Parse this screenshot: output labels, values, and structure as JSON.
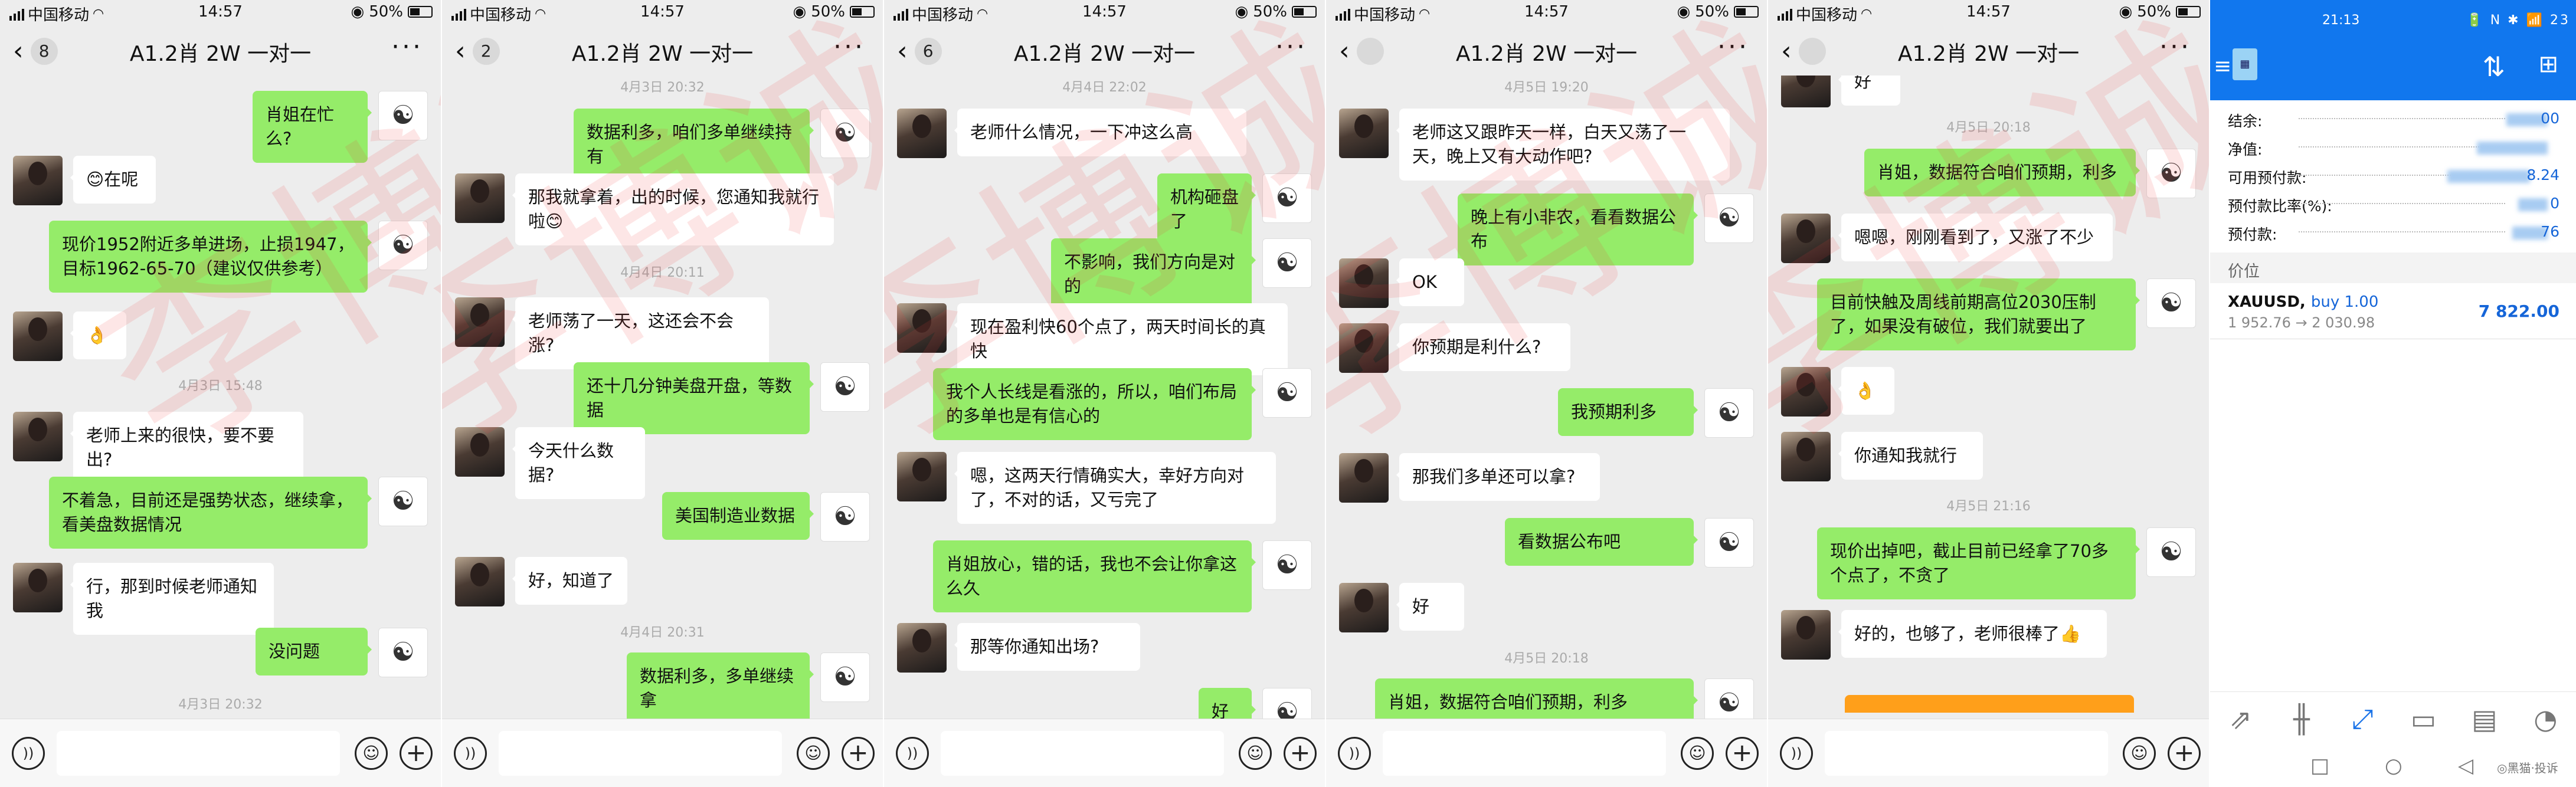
{
  "status": {
    "carrier": "中国移动",
    "time": "14:57",
    "battery": "50%"
  },
  "chat_title": "A1.2肖 2W 一对一",
  "panels": [
    {
      "unread": "8",
      "messages": [
        {
          "type": "out",
          "text": "肖姐在忙么?"
        },
        {
          "type": "in",
          "text": "😊在呢"
        },
        {
          "type": "out",
          "text": "现价1952附近多单进场，止损1947，目标1962-65-70（建议仅供参考）"
        },
        {
          "type": "in",
          "text": "👌"
        },
        {
          "type": "time",
          "text": "4月3日 15:48"
        },
        {
          "type": "in",
          "text": "老师上来的很快，要不要出?"
        },
        {
          "type": "out",
          "text": "不着急，目前还是强势状态，继续拿，看美盘数据情况"
        },
        {
          "type": "in",
          "text": "行，那到时候老师通知我"
        },
        {
          "type": "out",
          "text": "没问题"
        },
        {
          "type": "time",
          "text": "4月3日 20:32"
        }
      ]
    },
    {
      "unread": "2",
      "messages": [
        {
          "type": "time",
          "text": "4月3日 20:32"
        },
        {
          "type": "out",
          "text": "数据利多，咱们多单继续持有"
        },
        {
          "type": "in",
          "text": "那我就拿着，出的时候，您通知我就行啦😊"
        },
        {
          "type": "time",
          "text": "4月4日 20:11"
        },
        {
          "type": "in",
          "text": "老师荡了一天，这还会不会涨?"
        },
        {
          "type": "out",
          "text": "还十几分钟美盘开盘，等数据"
        },
        {
          "type": "in",
          "text": "今天什么数据?"
        },
        {
          "type": "out",
          "text": "美国制造业数据"
        },
        {
          "type": "in",
          "text": "好，知道了"
        },
        {
          "type": "time",
          "text": "4月4日 20:31"
        },
        {
          "type": "out",
          "text": "数据利多，多单继续拿"
        }
      ]
    },
    {
      "unread": "6",
      "messages": [
        {
          "type": "time",
          "text": "4月4日 22:02"
        },
        {
          "type": "in",
          "text": "老师什么情况，一下冲这么高"
        },
        {
          "type": "out",
          "text": "机构砸盘了"
        },
        {
          "type": "out",
          "text": "不影响，我们方向是对的"
        },
        {
          "type": "in",
          "text": "现在盈利快60个点了，两天时间长的真快"
        },
        {
          "type": "out",
          "text": "我个人长线是看涨的，所以，咱们布局的多单也是有信心的"
        },
        {
          "type": "in",
          "text": "嗯，这两天行情确实大，幸好方向对了，不对的话，又亏完了"
        },
        {
          "type": "out",
          "text": "肖姐放心，错的话，我也不会让你拿这么久"
        },
        {
          "type": "in",
          "text": "那等你通知出场?"
        },
        {
          "type": "out",
          "text": "好"
        }
      ]
    },
    {
      "unread": "",
      "messages": [
        {
          "type": "time",
          "text": "4月5日 19:20"
        },
        {
          "type": "in",
          "text": "老师这又跟昨天一样，白天又荡了一天，晚上又有大动作吧?"
        },
        {
          "type": "out",
          "text": "晚上有小非农，看看数据公布"
        },
        {
          "type": "in",
          "text": "OK"
        },
        {
          "type": "in",
          "text": "你预期是利什么?"
        },
        {
          "type": "out",
          "text": "我预期利多"
        },
        {
          "type": "in",
          "text": "那我们多单还可以拿?"
        },
        {
          "type": "out",
          "text": "看数据公布吧"
        },
        {
          "type": "in",
          "text": "好"
        },
        {
          "type": "time",
          "text": "4月5日 20:18"
        },
        {
          "type": "out",
          "text": "肖姐，数据符合咱们预期，利多"
        }
      ]
    },
    {
      "unread": "",
      "messages": [
        {
          "type": "in",
          "text": "好"
        },
        {
          "type": "time",
          "text": "4月5日 20:18"
        },
        {
          "type": "out",
          "text": "肖姐，数据符合咱们预期，利多"
        },
        {
          "type": "in",
          "text": "嗯嗯，刚刚看到了，又涨了不少"
        },
        {
          "type": "out",
          "text": "目前快触及周线前期高位2030压制了，如果没有破位，我们就要出了"
        },
        {
          "type": "in",
          "text": "👌"
        },
        {
          "type": "in",
          "text": "你通知我就行"
        },
        {
          "type": "time",
          "text": "4月5日 21:16"
        },
        {
          "type": "out",
          "text": "现价出掉吧，截止目前已经拿了70多个点了，不贪了"
        },
        {
          "type": "in",
          "text": "好的，也够了，老师很棒了👍"
        }
      ]
    }
  ],
  "watermark": "李博诚",
  "trade": {
    "status_time": "21:13",
    "status_icons": "🔋 N ✱ 📶 23",
    "rows": [
      {
        "label": "结余:",
        "value": "00"
      },
      {
        "label": "净值:",
        "value": ""
      },
      {
        "label": "可用预付款:",
        "value": "8.24"
      },
      {
        "label": "预付款比率(%):",
        "value": "0"
      },
      {
        "label": "预付款:",
        "value": "76"
      }
    ],
    "section_label": "价位",
    "position": {
      "symbol": "XAUUSD,",
      "side": "buy 1.00",
      "prices": "1 952.76 → 2 030.98",
      "profit": "7 822.00"
    },
    "footer_text": "◎黑猫·投诉"
  }
}
